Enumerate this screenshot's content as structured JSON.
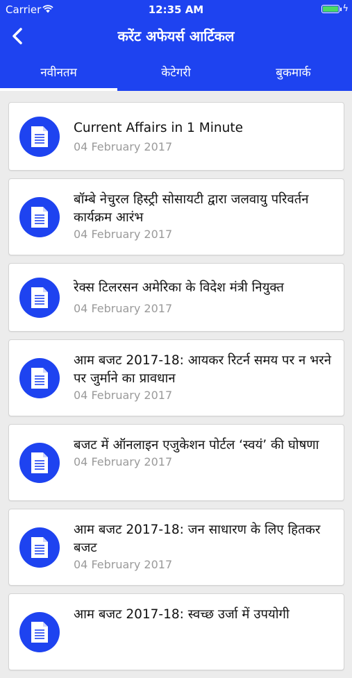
{
  "status_bar": {
    "carrier": "Carrier",
    "time": "12:35 AM"
  },
  "nav": {
    "title": "करेंट अफेयर्स आर्टिकल"
  },
  "tabs": [
    {
      "label": "नवीनतम",
      "active": true
    },
    {
      "label": "केटेगरी",
      "active": false
    },
    {
      "label": "बुकमार्क",
      "active": false
    }
  ],
  "colors": {
    "brand": "#1e43f0",
    "background": "#ececec",
    "battery": "#4cd964"
  },
  "articles": [
    {
      "title": "Current Affairs in 1 Minute",
      "date": "04 February 2017",
      "icon": "document-icon"
    },
    {
      "title": "बॉम्बे नेचुरल हिस्ट्री सोसायटी द्वारा जलवायु परिवर्तन कार्यक्रम आरंभ",
      "date": "04 February 2017",
      "icon": "document-icon"
    },
    {
      "title": "रेक्स टिलरसन अमेरिका के विदेश मंत्री नियुक्त",
      "date": "04 February 2017",
      "icon": "document-icon"
    },
    {
      "title": "आम बजट 2017-18: आयकर रिटर्न समय पर न भरने पर जुर्माने का प्रावधान",
      "date": "04 February 2017",
      "icon": "document-icon"
    },
    {
      "title": "बजट में ऑनलाइन एजुकेशन पोर्टल ‘स्वयं’ की घोषणा",
      "date": "04 February 2017",
      "icon": "document-icon"
    },
    {
      "title": "आम बजट 2017-18: जन साधारण के लिए हितकर बजट",
      "date": "04 February 2017",
      "icon": "document-icon"
    },
    {
      "title": "आम बजट 2017-18: स्वच्छ उर्जा में उपयोगी",
      "date": "",
      "icon": "document-icon"
    }
  ]
}
